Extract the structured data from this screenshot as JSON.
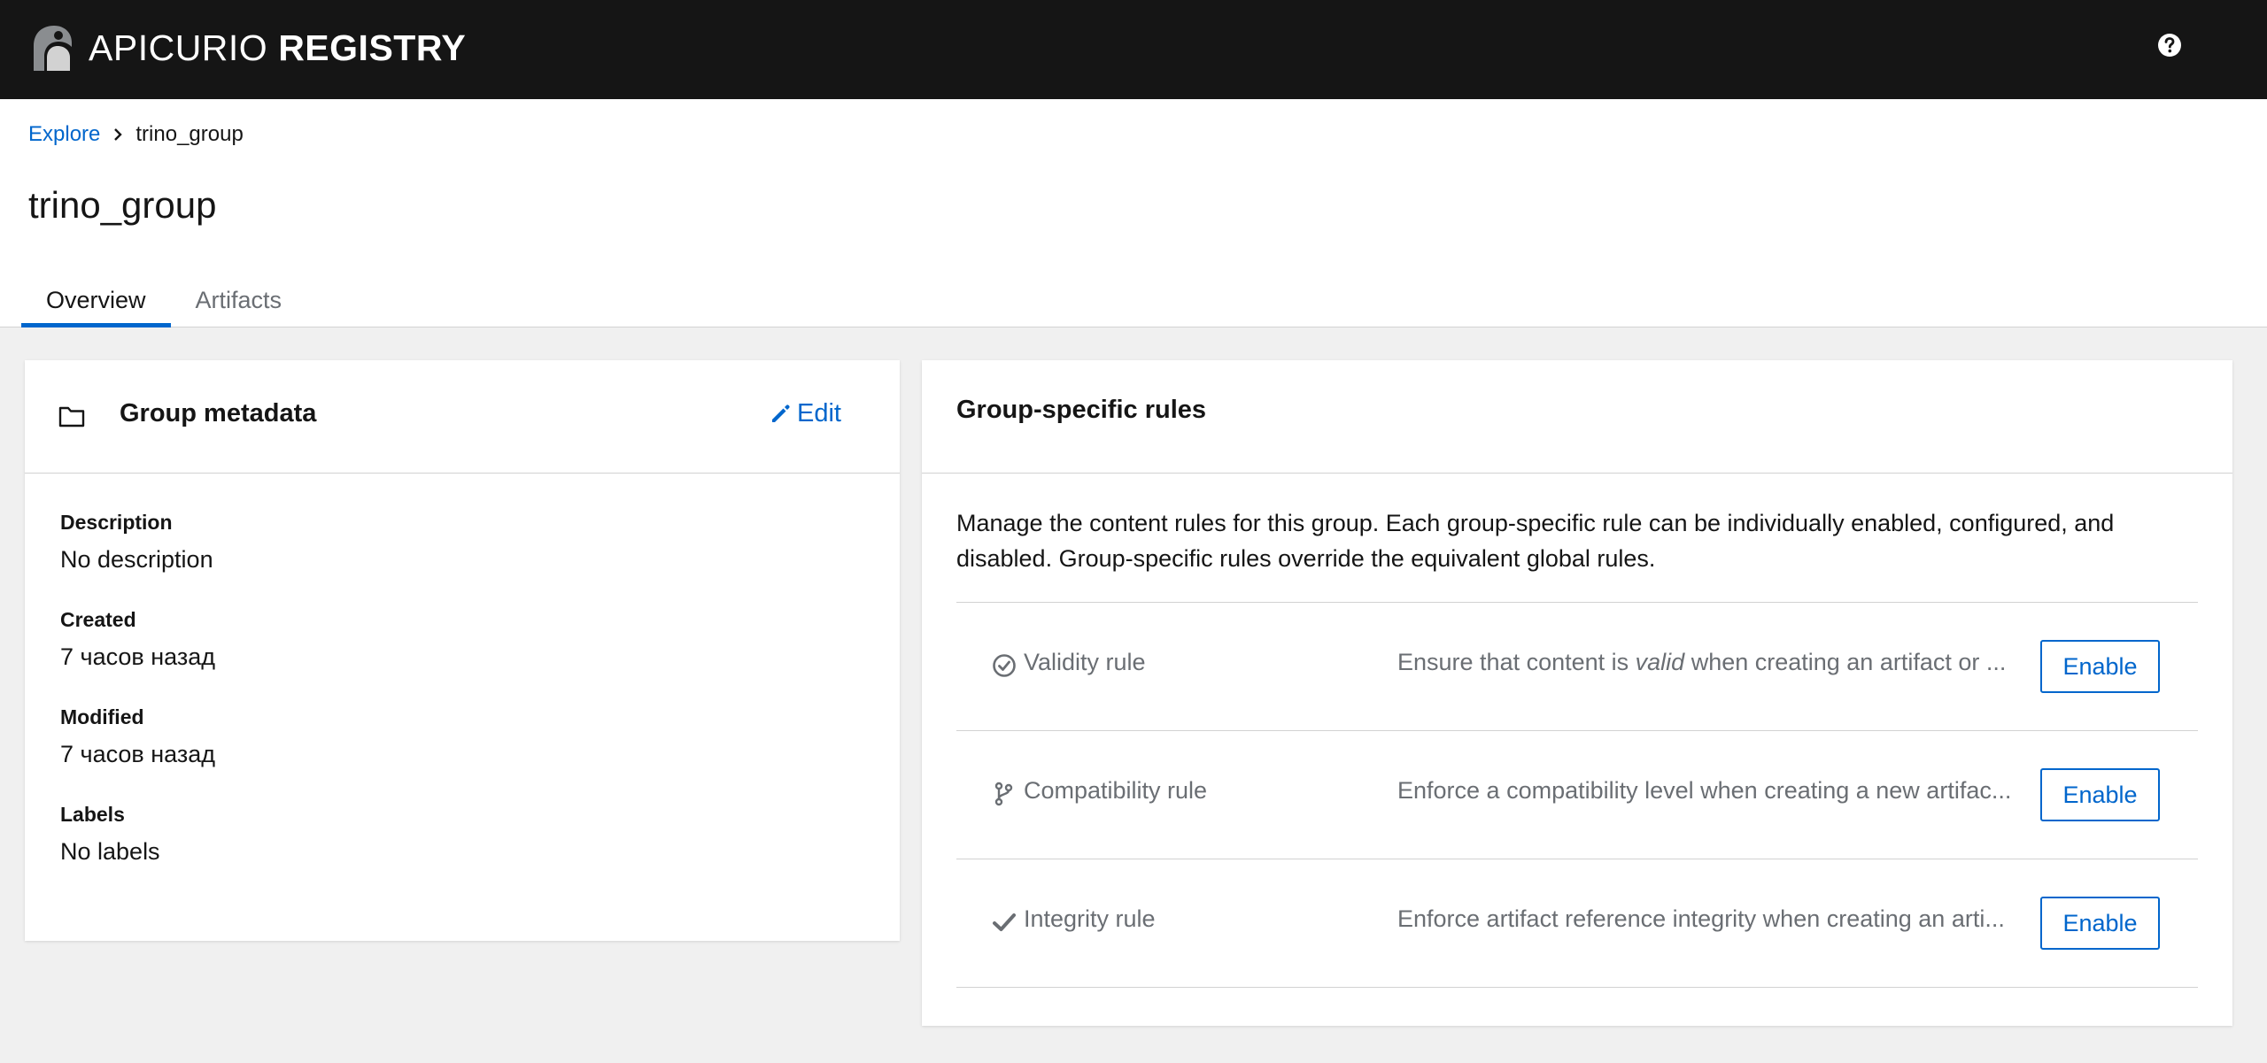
{
  "app": {
    "brand_light": "APICURIO",
    "brand_bold": "REGISTRY",
    "icons": {
      "logo": "apicurio-logo-icon",
      "help": "question-circle-icon"
    }
  },
  "breadcrumb": {
    "items": [
      {
        "label": "Explore",
        "link": true
      },
      {
        "label": "trino_group",
        "link": false
      }
    ],
    "separator_icon": "chevron-right-icon"
  },
  "page": {
    "title": "trino_group"
  },
  "tabs": [
    {
      "label": "Overview",
      "active": true
    },
    {
      "label": "Artifacts",
      "active": false
    }
  ],
  "metadata_card": {
    "title": "Group metadata",
    "icon": "folder-icon",
    "edit_label": "Edit",
    "edit_icon": "pencil-icon",
    "fields": [
      {
        "term": "Description",
        "value": "No description"
      },
      {
        "term": "Created",
        "value": "7 часов назад"
      },
      {
        "term": "Modified",
        "value": "7 часов назад"
      },
      {
        "term": "Labels",
        "value": "No labels"
      }
    ]
  },
  "rules_card": {
    "title": "Group-specific rules",
    "description": "Manage the content rules for this group. Each group-specific rule can be individually enabled, configured, and disabled. Group-specific rules override the equivalent global rules.",
    "rules": [
      {
        "name": "Validity rule",
        "icon": "check-circle-icon",
        "desc_before": "Ensure that content is ",
        "desc_emphasis": "valid",
        "desc_after": " when creating an artifact or ...",
        "button_label": "Enable"
      },
      {
        "name": "Compatibility rule",
        "icon": "code-branch-icon",
        "desc_before": "Enforce a compatibility level when creating a new artifac...",
        "desc_emphasis": "",
        "desc_after": "",
        "button_label": "Enable"
      },
      {
        "name": "Integrity rule",
        "icon": "check-icon",
        "desc_before": "Enforce artifact reference integrity when creating an arti...",
        "desc_emphasis": "",
        "desc_after": "",
        "button_label": "Enable"
      }
    ]
  },
  "colors": {
    "masthead": "#151515",
    "link": "#0066cc",
    "page_background": "#f0f0f0",
    "muted_text": "#6a6e73",
    "divider": "#d2d2d2"
  }
}
